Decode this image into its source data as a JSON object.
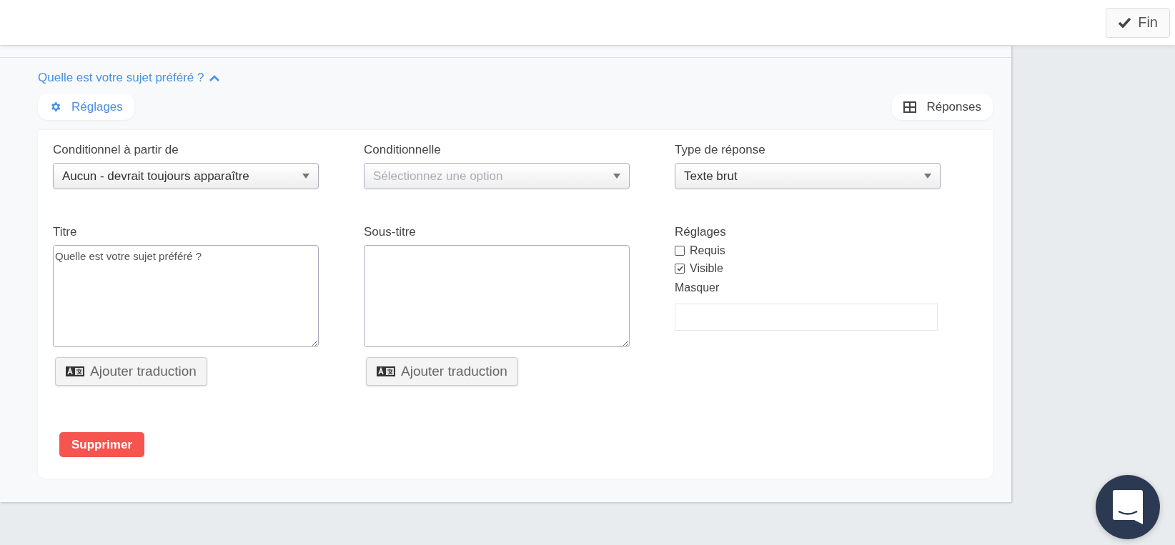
{
  "top_bar": {
    "done_button": {
      "label": "Fin"
    }
  },
  "question": {
    "title": "Quelle est votre sujet préféré ?",
    "expanded": true
  },
  "toolbar": {
    "settings_button": {
      "label": "Réglages"
    },
    "answers_button": {
      "label": "Réponses"
    }
  },
  "selects": [
    {
      "label": "Conditionnel à partir de",
      "value": "Aucun - devrait toujours apparaître"
    },
    {
      "label": "Conditionnelle",
      "placeholder": "Sélectionnez une option"
    },
    {
      "label": "Type de réponse",
      "value": "Texte brut"
    }
  ],
  "text_areas": [
    {
      "label": "Titre",
      "value": "Quelle est votre sujet préféré ?",
      "translate_button": "Ajouter traduction"
    },
    {
      "label": "Sous-titre",
      "translate_button": "Ajouter traduction"
    }
  ],
  "settings": {
    "label": "Réglages",
    "options": [
      {
        "label": "Requis",
        "checked": false
      },
      {
        "label": "Visible",
        "checked": true
      }
    ],
    "hide_label": "Masquer"
  },
  "delete_button": {
    "label": "Supprimer"
  }
}
